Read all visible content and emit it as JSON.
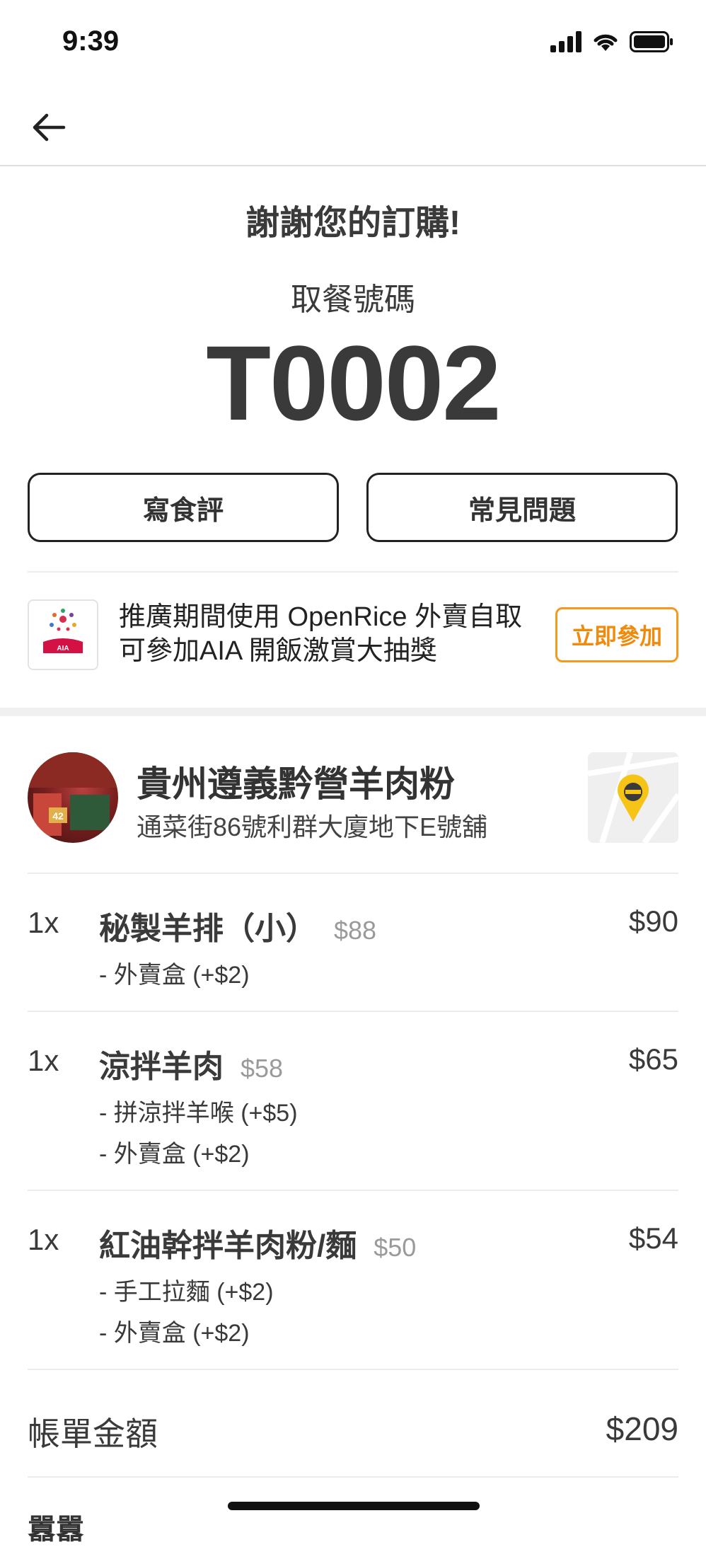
{
  "status_bar": {
    "time": "9:39"
  },
  "header": {
    "back_icon": "arrow-left-icon"
  },
  "confirmation": {
    "thanks": "謝謝您的訂購!",
    "pickup_label": "取餐號碼",
    "pickup_number": "T0002"
  },
  "actions": {
    "review_label": "寫食評",
    "faq_label": "常見問題"
  },
  "promo": {
    "line1": "推廣期間使用 OpenRice 外賣自取",
    "line2": "可參加AIA 開飯激賞大抽獎",
    "logo_text": "AIA",
    "join_label": "立即參加",
    "accent_color": "#f08a0c"
  },
  "restaurant": {
    "name": "貴州遵義黔營羊肉粉",
    "address": "通菜街86號利群大廈地下E號舖",
    "photo_label": "42"
  },
  "items": [
    {
      "qty": "1x",
      "name": "秘製羊排（小）",
      "unit_price": "$88",
      "total": "$90",
      "options": [
        "- 外賣盒 (+$2)"
      ]
    },
    {
      "qty": "1x",
      "name": "涼拌羊肉",
      "unit_price": "$58",
      "total": "$65",
      "options": [
        "- 拼涼拌羊喉 (+$5)",
        "- 外賣盒 (+$2)"
      ]
    },
    {
      "qty": "1x",
      "name": "紅油幹拌羊肉粉/麵",
      "unit_price": "$50",
      "total": "$54",
      "options": [
        "- 手工拉麵 (+$2)",
        "- 外賣盒 (+$2)"
      ]
    }
  ],
  "bill": {
    "label": "帳單金額",
    "value": "$209"
  },
  "bottom_peek": {
    "text": "囂囂"
  }
}
